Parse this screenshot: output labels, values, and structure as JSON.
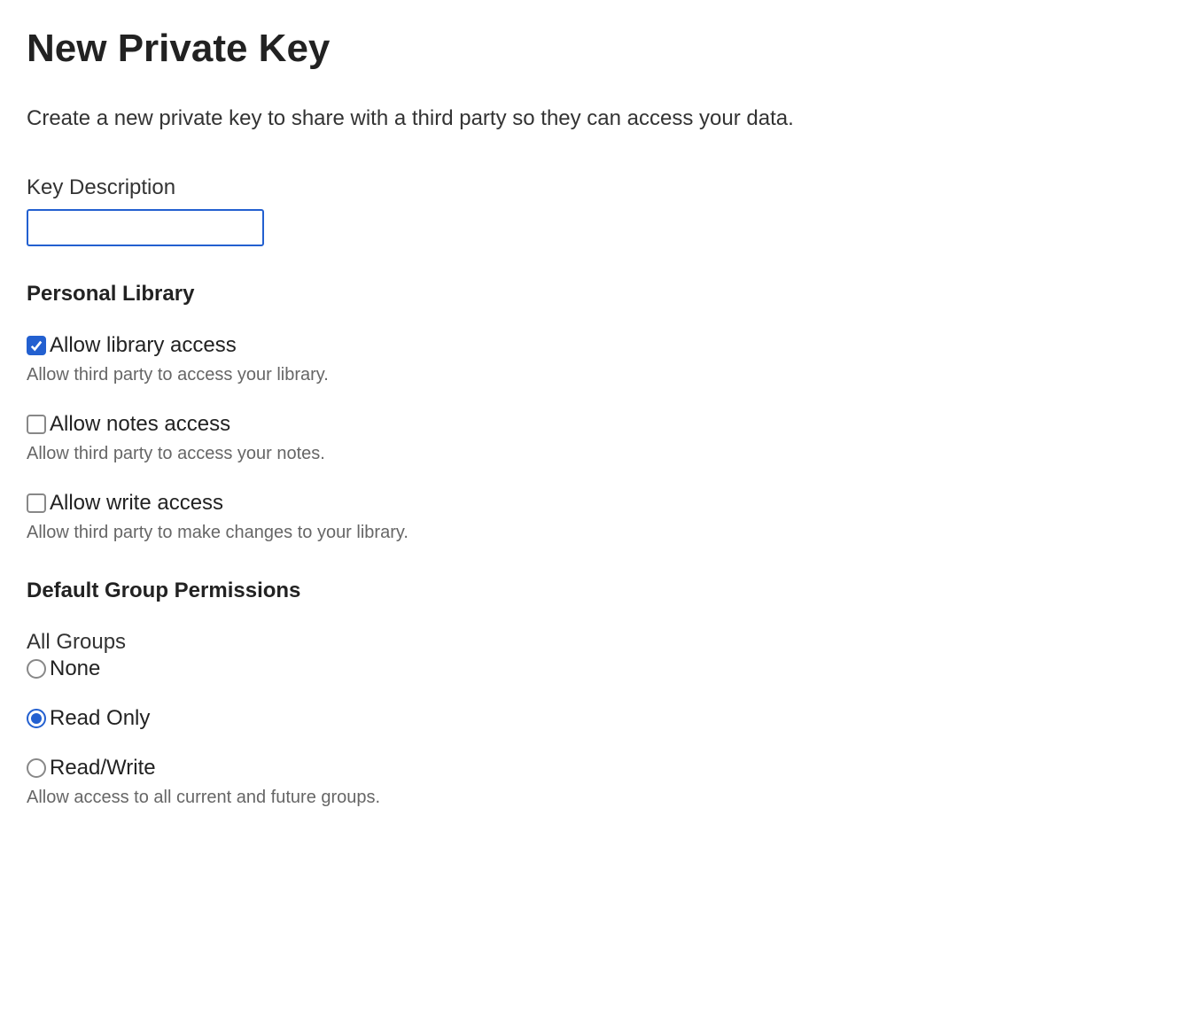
{
  "page": {
    "title": "New Private Key",
    "description": "Create a new private key to share with a third party so they can access your data."
  },
  "keyDescription": {
    "label": "Key Description",
    "value": ""
  },
  "personalLibrary": {
    "heading": "Personal Library",
    "options": [
      {
        "label": "Allow library access",
        "desc": "Allow third party to access your library.",
        "checked": true
      },
      {
        "label": "Allow notes access",
        "desc": "Allow third party to access your notes.",
        "checked": false
      },
      {
        "label": "Allow write access",
        "desc": "Allow third party to make changes to your library.",
        "checked": false
      }
    ]
  },
  "groupPermissions": {
    "heading": "Default Group Permissions",
    "subheading": "All Groups",
    "options": [
      {
        "label": "None",
        "selected": false
      },
      {
        "label": "Read Only",
        "selected": true
      },
      {
        "label": "Read/Write",
        "selected": false
      }
    ],
    "desc": "Allow access to all current and future groups."
  }
}
